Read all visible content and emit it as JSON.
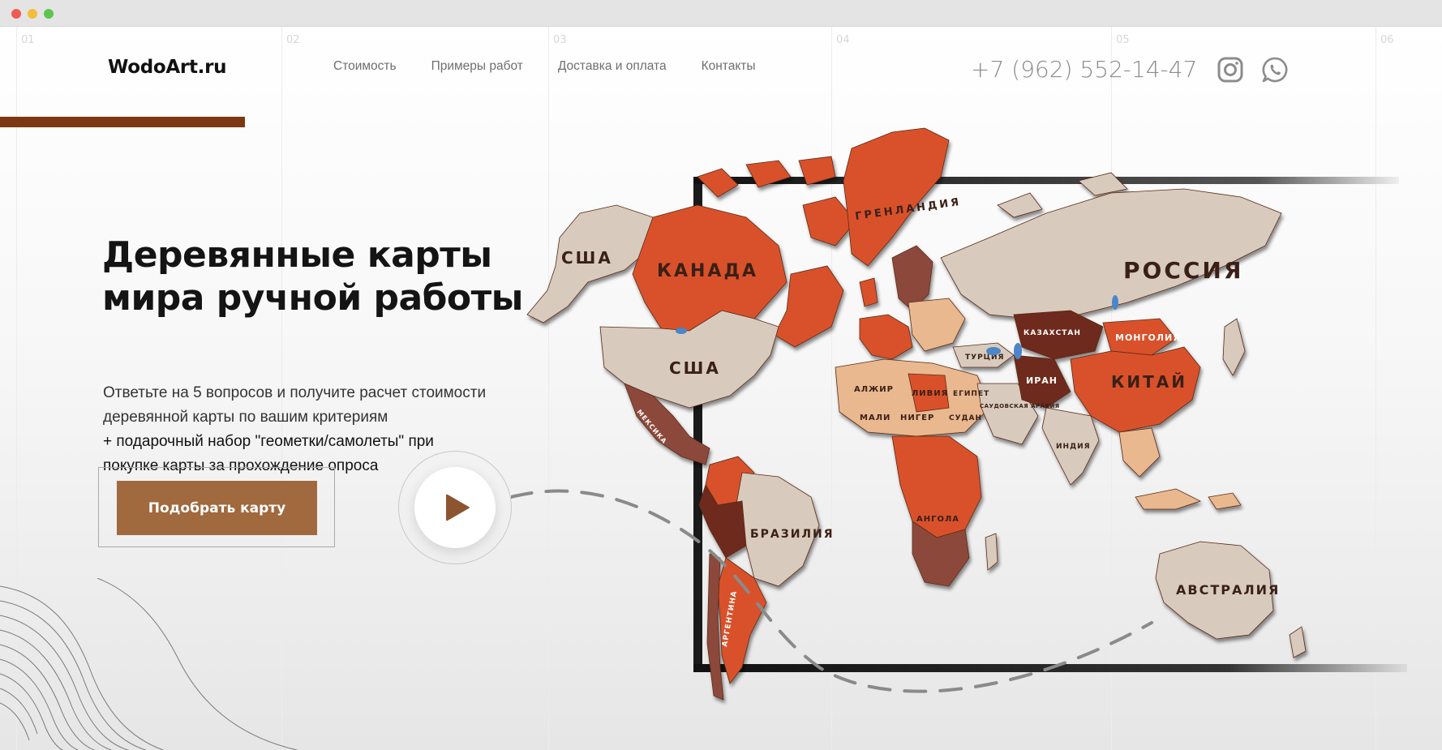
{
  "brand": {
    "name": "WodoArt.ru"
  },
  "columns": [
    "01",
    "02",
    "03",
    "04",
    "05",
    "06"
  ],
  "nav": {
    "items": [
      {
        "label": "Стоимость"
      },
      {
        "label": "Примеры работ"
      },
      {
        "label": "Доставка и оплата"
      },
      {
        "label": "Контакты"
      }
    ]
  },
  "contacts": {
    "phone": "+7 (962) 552-14-47",
    "icons": [
      "instagram-icon",
      "whatsapp-icon"
    ]
  },
  "hero": {
    "title_line1": "Деревянные карты",
    "title_line2": "мира ручной работы",
    "subtitle_line1": "Ответьте на 5 вопросов и получите расчет стоимости",
    "subtitle_line2": "деревянной карты по вашим критериям",
    "gift_line1": "+ подарочный набор \"геометки/самолеты\" при",
    "gift_line2": "покупке карты за прохождение опроса",
    "cta_label": "Подобрать карту"
  },
  "map": {
    "labels": {
      "usa_alaska": "США",
      "canada": "КАНАДА",
      "usa": "США",
      "greenland": "ГРЕНЛАНДИЯ",
      "russia": "РОССИЯ",
      "mongolia": "МОНГОЛИЯ",
      "china": "КИТАЙ",
      "kazakhstan": "КАЗАХСТАН",
      "iran": "ИРАН",
      "turkey": "ТУРЦИЯ",
      "algeria": "АЛЖИР",
      "libya": "ЛИВИЯ",
      "egypt": "ЕГИПЕТ",
      "mali": "МАЛИ",
      "niger": "НИГЕР",
      "sudan": "СУДАН",
      "saudi": "САУДОВСКАЯ АРАВИЯ",
      "angola": "АНГОЛА",
      "brazil": "БРАЗИЛИЯ",
      "argentina": "АРГЕНТИНА",
      "australia": "АВСТРАЛИЯ",
      "india": "ИНДИЯ",
      "mexico": "МЕКСИКА"
    }
  },
  "colors": {
    "brand_bar": "#7c3810",
    "cta_bg": "#a0693e",
    "wood_light": "#d8cbbd",
    "wood_orange": "#d9512c",
    "wood_dark": "#6e2a1c",
    "wood_tan": "#e9b88e"
  }
}
